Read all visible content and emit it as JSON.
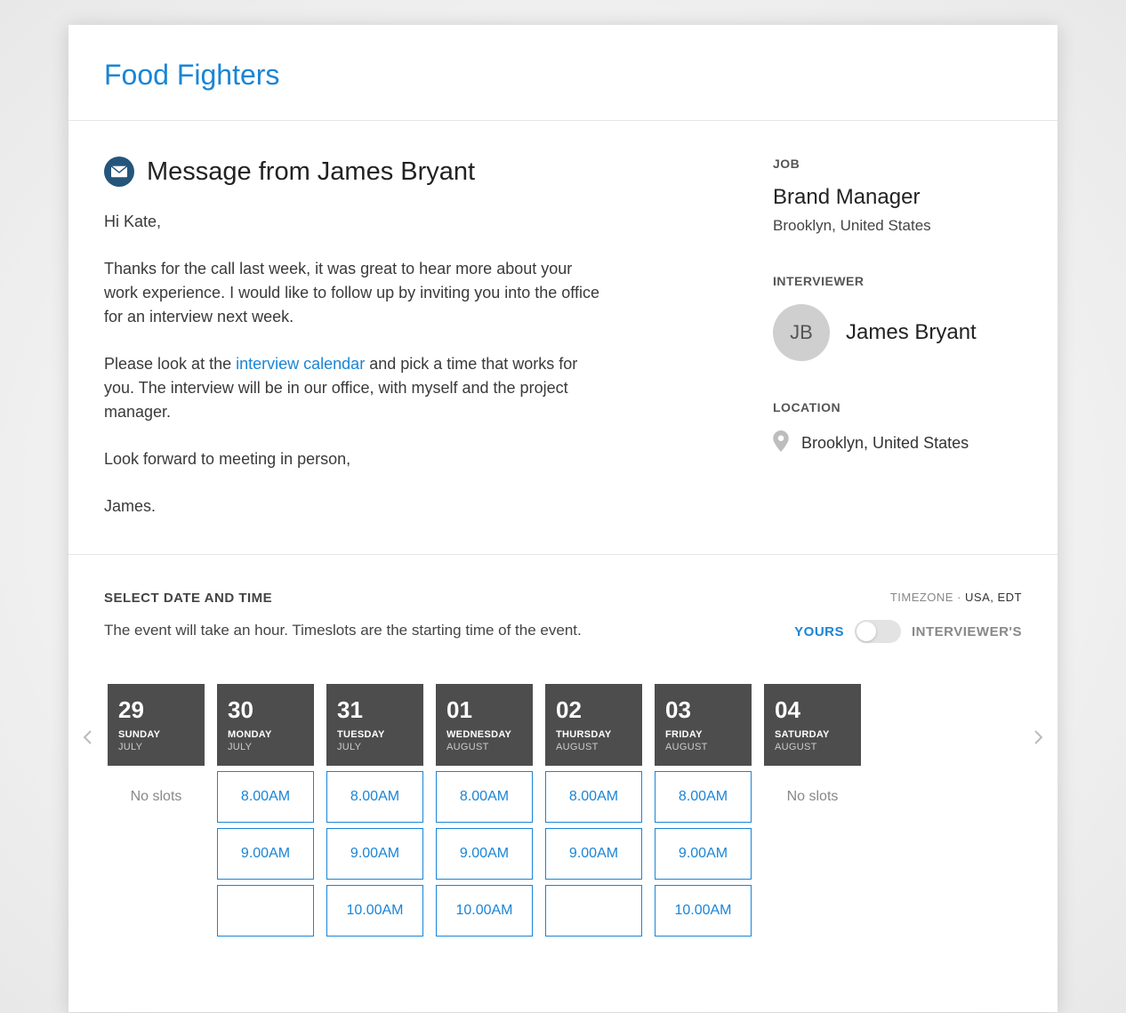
{
  "brand": "Food Fighters",
  "message": {
    "title": "Message from James Bryant",
    "greeting": "Hi Kate,",
    "p1": "Thanks for the call last week, it was great to hear more about your work experience. I would like to follow up by inviting you into the office for an interview next week.",
    "p2a": "Please look at the ",
    "link": "interview calendar",
    "p2b": " and pick a time that works for you. The interview will be in our office, with myself and the project manager.",
    "p3": "Look forward to meeting in person,",
    "sign": "James."
  },
  "sidebar": {
    "job_label": "JOB",
    "job_title": "Brand Manager",
    "job_location": "Brooklyn, United States",
    "interviewer_label": "INTERVIEWER",
    "interviewer_initials": "JB",
    "interviewer_name": "James Bryant",
    "location_label": "LOCATION",
    "location_text": "Brooklyn, United States"
  },
  "calendar": {
    "select_label": "SELECT DATE AND TIME",
    "description": "The event will take an hour. Timeslots are the starting time of the event.",
    "tz_label": "TIMEZONE · ",
    "tz_value": "USA, EDT",
    "toggle_left": "YOURS",
    "toggle_right": "INTERVIEWER'S",
    "no_slots": "No slots",
    "days": [
      {
        "num": "29",
        "name": "SUNDAY",
        "month": "JULY",
        "slots": []
      },
      {
        "num": "30",
        "name": "MONDAY",
        "month": "JULY",
        "slots": [
          "8.00AM",
          "9.00AM",
          ""
        ]
      },
      {
        "num": "31",
        "name": "TUESDAY",
        "month": "JULY",
        "slots": [
          "8.00AM",
          "9.00AM",
          "10.00AM"
        ]
      },
      {
        "num": "01",
        "name": "WEDNESDAY",
        "month": "AUGUST",
        "slots": [
          "8.00AM",
          "9.00AM",
          "10.00AM"
        ]
      },
      {
        "num": "02",
        "name": "THURSDAY",
        "month": "AUGUST",
        "slots": [
          "8.00AM",
          "9.00AM",
          ""
        ]
      },
      {
        "num": "03",
        "name": "FRIDAY",
        "month": "AUGUST",
        "slots": [
          "8.00AM",
          "9.00AM",
          "10.00AM"
        ]
      },
      {
        "num": "04",
        "name": "SATURDAY",
        "month": "AUGUST",
        "slots": []
      }
    ]
  }
}
